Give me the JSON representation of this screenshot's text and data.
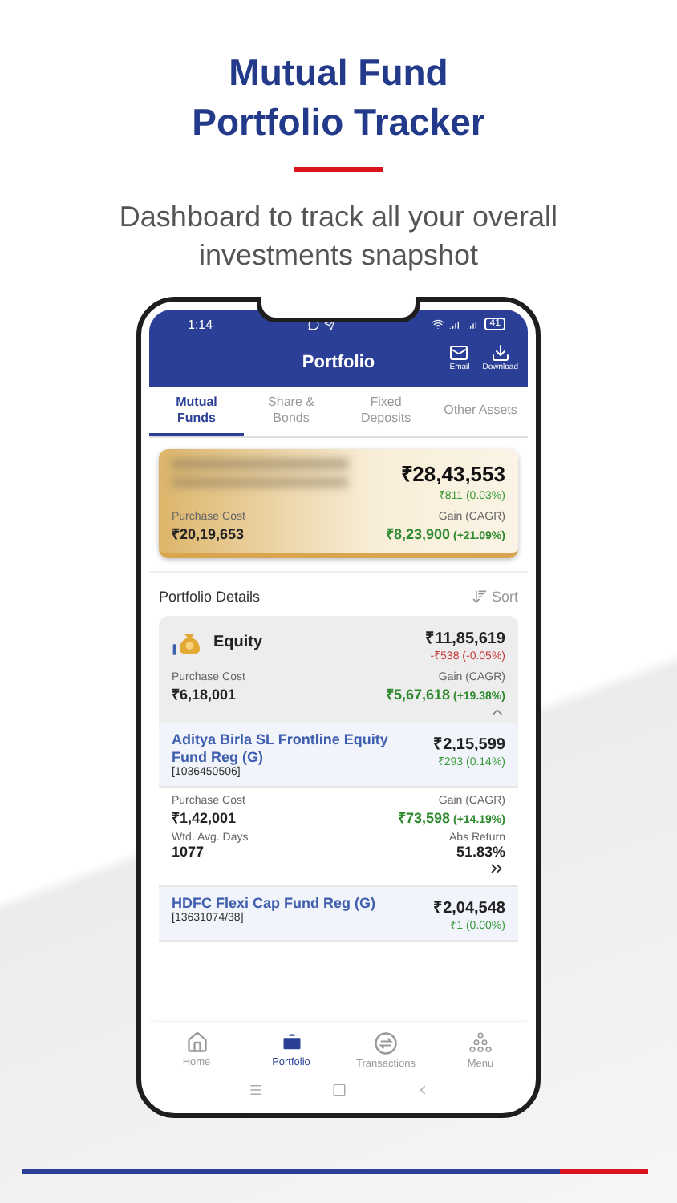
{
  "headline": {
    "lines": [
      "Mutual Fund",
      "Portfolio Tracker"
    ],
    "subtitle": "Dashboard to track all your overall investments snapshot"
  },
  "status_bar": {
    "time": "1:14",
    "battery": "41"
  },
  "app_bar": {
    "title": "Portfolio",
    "actions": [
      {
        "kind": "mail",
        "label": "Email"
      },
      {
        "kind": "download",
        "label": "Download"
      }
    ]
  },
  "tabs": [
    {
      "label": "Mutual Funds",
      "selected": true
    },
    {
      "label": "Share & Bonds",
      "selected": false
    },
    {
      "label": "Fixed Deposits",
      "selected": false
    },
    {
      "label": "Other Assets",
      "selected": false
    }
  ],
  "summary": {
    "value": "₹28,43,553",
    "change": "₹811 (0.03%)",
    "negative": false,
    "cost_label": "Purchase Cost",
    "cost": "₹20,19,653",
    "gain_label": "Gain (CAGR)",
    "gain": "₹8,23,900",
    "gain_pct": "(+21.09%)"
  },
  "details": {
    "title": "Portfolio Details",
    "sort": "Sort"
  },
  "category": {
    "name": "Equity",
    "value": "₹11,85,619",
    "change": "-₹538 (-0.05%)",
    "negative": true,
    "cost_label": "Purchase Cost",
    "cost": "₹6,18,001",
    "gain_label": "Gain (CAGR)",
    "gain": "₹5,67,618",
    "gain_pct": "(+19.38%)",
    "expanded": true
  },
  "funds": [
    {
      "name": "Aditya Birla SL Frontline Equity Fund Reg (G)",
      "code": "[1036450506]",
      "value": "₹2,15,599",
      "change": "₹293 (0.14%)",
      "negative": false,
      "expanded": true,
      "cost_label": "Purchase Cost",
      "cost": "₹1,42,001",
      "gain_label": "Gain (CAGR)",
      "gain": "₹73,598",
      "gain_pct": "(+14.19%)",
      "days_label": "Wtd. Avg. Days",
      "days": "1077",
      "abs_label": "Abs Return",
      "abs": "51.83%"
    },
    {
      "name": "HDFC Flexi Cap Fund Reg (G)",
      "code": "[13631074/38]",
      "value": "₹2,04,548",
      "change": "₹1 (0.00%)",
      "negative": false,
      "expanded": false
    }
  ],
  "bottom_nav": [
    {
      "kind": "home",
      "label": "Home",
      "selected": false
    },
    {
      "kind": "portfolio",
      "label": "Portfolio",
      "selected": true
    },
    {
      "kind": "transactions",
      "label": "Transactions",
      "selected": false
    },
    {
      "kind": "menu",
      "label": "Menu",
      "selected": false
    }
  ]
}
